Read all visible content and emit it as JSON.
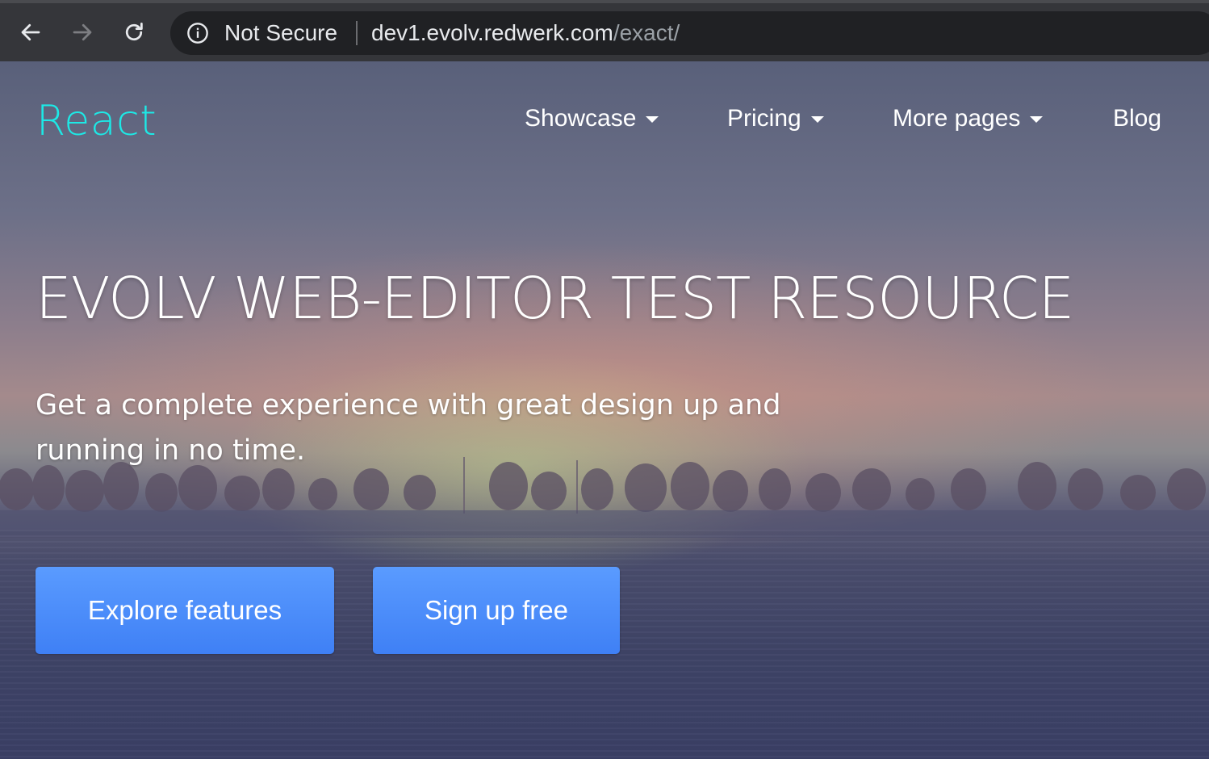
{
  "browser": {
    "security_label": "Not Secure",
    "url_host": "dev1.evolv.redwerk.com",
    "url_path": "/exact/",
    "icons": [
      "back-arrow-icon",
      "forward-arrow-icon",
      "reload-icon",
      "info-icon"
    ]
  },
  "site": {
    "logo": "React",
    "nav": [
      {
        "label": "Showcase",
        "dropdown": true
      },
      {
        "label": "Pricing",
        "dropdown": true
      },
      {
        "label": "More pages",
        "dropdown": true
      },
      {
        "label": "Blog",
        "dropdown": false
      }
    ]
  },
  "hero": {
    "headline": "EVOLV WEB-EDITOR TEST RESOURCE",
    "subtitle": "Get a complete experience with great design up and running in no time.",
    "primary_button": "Explore features",
    "secondary_button": "Sign up free"
  },
  "colors": {
    "logo": "#1de9e6",
    "button": "#4a8cf8",
    "chrome": "#35363a",
    "omnibox": "#202124"
  }
}
